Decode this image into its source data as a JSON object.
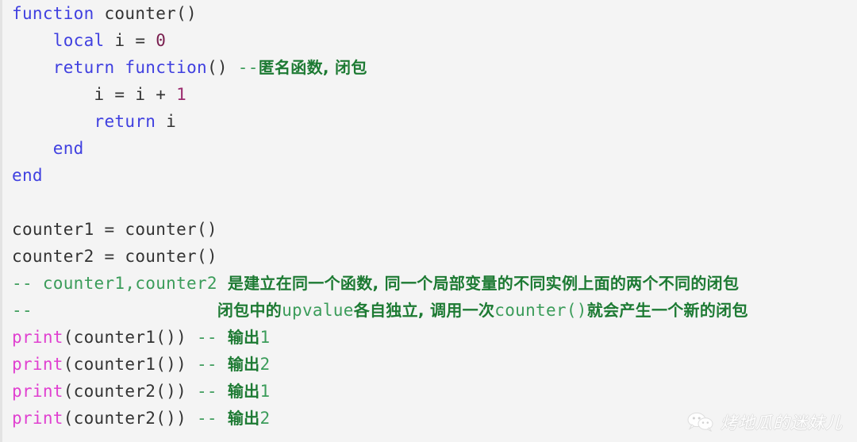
{
  "document": {
    "language": "lua",
    "background_color": "#f4f4f4",
    "border_color": "#e3e3e3"
  },
  "colors": {
    "keyword": "#4040e0",
    "plain": "#333333",
    "number": "#9b2b6e",
    "function_name": "#e040d0",
    "comment_ascii": "#3b9c5a",
    "comment_cjk": "#1d7a33"
  },
  "code": {
    "lines": [
      {
        "index": 1,
        "text": "function counter()",
        "tokens": [
          {
            "t": "function",
            "k": "keyword"
          },
          {
            "t": " counter()",
            "k": "plain"
          }
        ]
      },
      {
        "index": 2,
        "text": "    local i = 0",
        "tokens": [
          {
            "t": "    ",
            "k": "plain"
          },
          {
            "t": "local",
            "k": "keyword"
          },
          {
            "t": " i = ",
            "k": "plain"
          },
          {
            "t": "0",
            "k": "number-d"
          }
        ]
      },
      {
        "index": 3,
        "text": "    return function() --匿名函数, 闭包",
        "tokens": [
          {
            "t": "    ",
            "k": "plain"
          },
          {
            "t": "return",
            "k": "keyword"
          },
          {
            "t": " ",
            "k": "plain"
          },
          {
            "t": "function",
            "k": "keyword"
          },
          {
            "t": "() ",
            "k": "plain"
          },
          {
            "t": "--",
            "k": "comment"
          },
          {
            "t": "匿名函数, 闭包",
            "k": "comment-cjk"
          }
        ]
      },
      {
        "index": 4,
        "text": "        i = i + 1",
        "tokens": [
          {
            "t": "        i = i + ",
            "k": "plain"
          },
          {
            "t": "1",
            "k": "number"
          }
        ]
      },
      {
        "index": 5,
        "text": "        return i",
        "tokens": [
          {
            "t": "        ",
            "k": "plain"
          },
          {
            "t": "return",
            "k": "keyword"
          },
          {
            "t": " i",
            "k": "plain"
          }
        ]
      },
      {
        "index": 6,
        "text": "    end",
        "tokens": [
          {
            "t": "    ",
            "k": "plain"
          },
          {
            "t": "end",
            "k": "keyword"
          }
        ]
      },
      {
        "index": 7,
        "text": "end",
        "tokens": [
          {
            "t": "end",
            "k": "keyword"
          }
        ]
      },
      {
        "index": 8,
        "text": "",
        "tokens": []
      },
      {
        "index": 9,
        "text": "counter1 = counter()",
        "tokens": [
          {
            "t": "counter1 = counter()",
            "k": "plain"
          }
        ]
      },
      {
        "index": 10,
        "text": "counter2 = counter()",
        "tokens": [
          {
            "t": "counter2 = counter()",
            "k": "plain"
          }
        ]
      },
      {
        "index": 11,
        "text": "-- counter1,counter2 是建立在同一个函数, 同一个局部变量的不同实例上面的两个不同的闭包",
        "tokens": [
          {
            "t": "-- counter1,counter2 ",
            "k": "comment"
          },
          {
            "t": "是建立在同一个函数, 同一个局部变量的不同实例上面的两个不同的闭包",
            "k": "comment-cjk"
          }
        ]
      },
      {
        "index": 12,
        "text": "--                  闭包中的upvalue各自独立, 调用一次counter()就会产生一个新的闭包",
        "tokens": [
          {
            "t": "--                  ",
            "k": "comment"
          },
          {
            "t": "闭包中的",
            "k": "comment-cjk"
          },
          {
            "t": "upvalue",
            "k": "comment"
          },
          {
            "t": "各自独立, 调用一次",
            "k": "comment-cjk"
          },
          {
            "t": "counter()",
            "k": "comment"
          },
          {
            "t": "就会产生一个新的闭包",
            "k": "comment-cjk"
          }
        ]
      },
      {
        "index": 13,
        "text": "print(counter1()) -- 输出1",
        "tokens": [
          {
            "t": "print",
            "k": "func"
          },
          {
            "t": "(counter1()) ",
            "k": "plain"
          },
          {
            "t": "-- ",
            "k": "comment"
          },
          {
            "t": "输出",
            "k": "comment-cjk"
          },
          {
            "t": "1",
            "k": "comment"
          }
        ]
      },
      {
        "index": 14,
        "text": "print(counter1()) -- 输出2",
        "tokens": [
          {
            "t": "print",
            "k": "func"
          },
          {
            "t": "(counter1()) ",
            "k": "plain"
          },
          {
            "t": "-- ",
            "k": "comment"
          },
          {
            "t": "输出",
            "k": "comment-cjk"
          },
          {
            "t": "2",
            "k": "comment"
          }
        ]
      },
      {
        "index": 15,
        "text": "print(counter2()) -- 输出1",
        "tokens": [
          {
            "t": "print",
            "k": "func"
          },
          {
            "t": "(counter2()) ",
            "k": "plain"
          },
          {
            "t": "-- ",
            "k": "comment"
          },
          {
            "t": "输出",
            "k": "comment-cjk"
          },
          {
            "t": "1",
            "k": "comment"
          }
        ]
      },
      {
        "index": 16,
        "text": "print(counter2()) -- 输出2",
        "tokens": [
          {
            "t": "print",
            "k": "func"
          },
          {
            "t": "(counter2()) ",
            "k": "plain"
          },
          {
            "t": "-- ",
            "k": "comment"
          },
          {
            "t": "输出",
            "k": "comment-cjk"
          },
          {
            "t": "2",
            "k": "comment"
          }
        ]
      }
    ]
  },
  "watermark": {
    "icon": "wechat-icon",
    "text": "烤地瓜的迷妹儿"
  }
}
